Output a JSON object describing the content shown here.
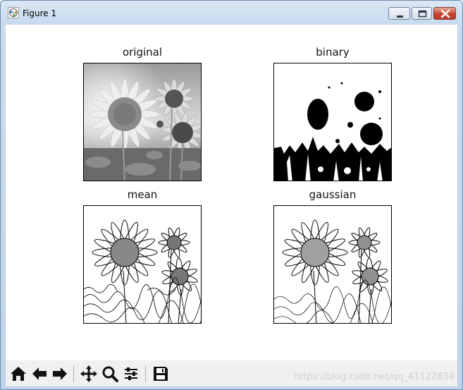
{
  "window": {
    "title": "Figure 1",
    "controls": [
      "minimize",
      "maximize",
      "close"
    ]
  },
  "figure": {
    "panels": [
      {
        "title": "original",
        "kind": "grayscale-photo"
      },
      {
        "title": "binary",
        "kind": "threshold"
      },
      {
        "title": "mean",
        "kind": "adaptive-mean"
      },
      {
        "title": "gaussian",
        "kind": "adaptive-gaussian"
      }
    ]
  },
  "toolbar": {
    "buttons": [
      "home-icon",
      "back-icon",
      "forward-icon",
      "pan-icon",
      "zoom-icon",
      "configure-subplots-icon",
      "save-icon"
    ]
  },
  "watermark": "https://blog.csdn.net/qq_41122834"
}
